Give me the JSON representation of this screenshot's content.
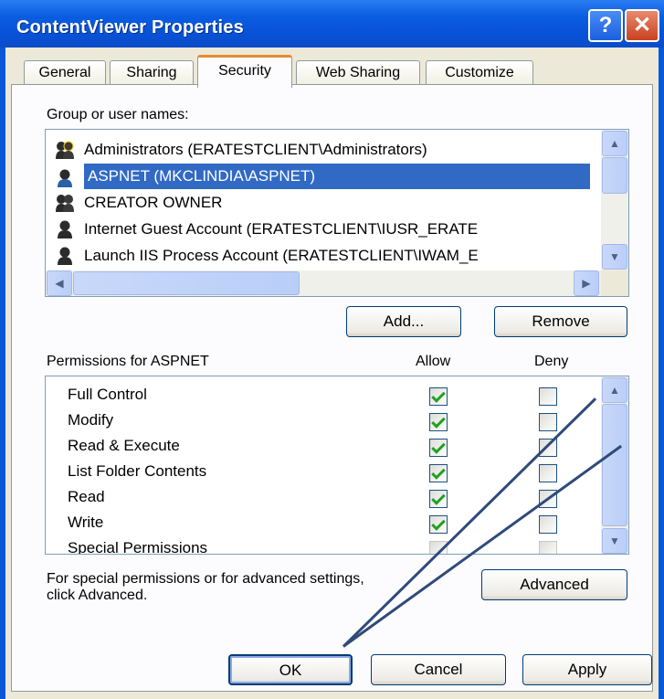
{
  "window": {
    "title": "ContentViewer Properties",
    "help_glyph": "?",
    "close_glyph": "✕"
  },
  "tabs": [
    {
      "label": "General",
      "active": false
    },
    {
      "label": "Sharing",
      "active": false
    },
    {
      "label": "Security",
      "active": true
    },
    {
      "label": "Web Sharing",
      "active": false
    },
    {
      "label": "Customize",
      "active": false
    }
  ],
  "users": {
    "label": "Group or user names:",
    "items": [
      {
        "name": "Administrators (ERATESTCLIENT\\Administrators)",
        "icon": "group-icon",
        "selected": false
      },
      {
        "name": "ASPNET (MKCLINDIA\\ASPNET)",
        "icon": "user-icon",
        "selected": true
      },
      {
        "name": "CREATOR OWNER",
        "icon": "group-icon",
        "selected": false
      },
      {
        "name": "Internet Guest Account (ERATESTCLIENT\\IUSR_ERATE",
        "icon": "user-icon",
        "selected": false
      },
      {
        "name": "Launch IIS Process Account (ERATESTCLIENT\\IWAM_E",
        "icon": "user-icon",
        "selected": false
      }
    ],
    "add_label": "Add...",
    "remove_label": "Remove"
  },
  "permissions": {
    "title": "Permissions for ASPNET",
    "allow_header": "Allow",
    "deny_header": "Deny",
    "rows": [
      {
        "name": "Full Control",
        "allow": true,
        "deny": false
      },
      {
        "name": "Modify",
        "allow": true,
        "deny": false
      },
      {
        "name": "Read & Execute",
        "allow": true,
        "deny": false
      },
      {
        "name": "List Folder Contents",
        "allow": true,
        "deny": false
      },
      {
        "name": "Read",
        "allow": true,
        "deny": false
      },
      {
        "name": "Write",
        "allow": true,
        "deny": false
      },
      {
        "name": "Special Permissions",
        "allow": false,
        "deny": false
      }
    ]
  },
  "advanced": {
    "text_line1": "For special permissions or for advanced settings,",
    "text_line2": "click Advanced.",
    "button_label": "Advanced"
  },
  "footer": {
    "ok_label": "OK",
    "cancel_label": "Cancel",
    "apply_label": "Apply"
  },
  "colors": {
    "title_bar": "#0a56d8",
    "selection": "#316ac5",
    "active_tab_accent": "#e68b2c",
    "check_mark": "#21a121",
    "annotation_arrow": "#2f4a7a"
  }
}
